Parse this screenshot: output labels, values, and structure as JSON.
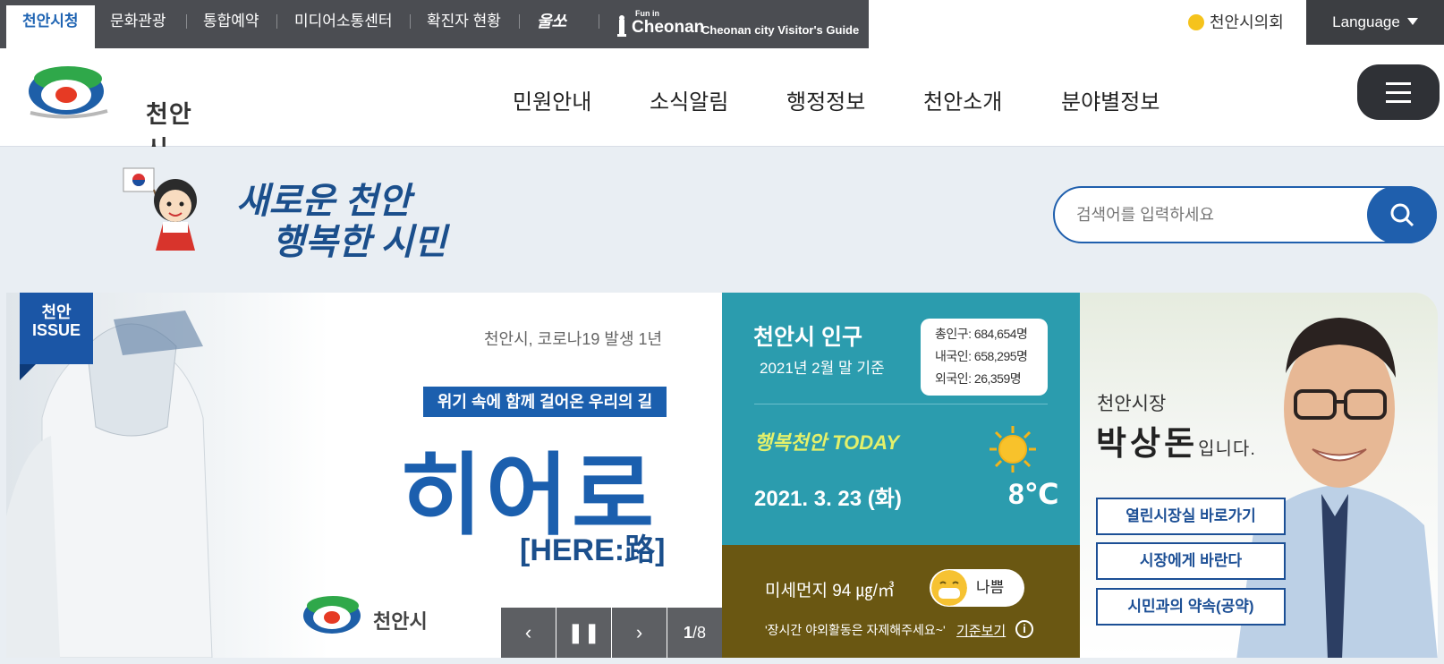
{
  "topbar": {
    "links": [
      "천안시청",
      "문화관광",
      "통합예약",
      "미디어소통센터",
      "확진자 현황"
    ],
    "ulsso": "울쏘",
    "fun_small": "Fun in",
    "fun_brand": "Cheonan",
    "fun_guide": "Cheonan city Visitor's Guide",
    "council": "천안시의회",
    "language": "Language"
  },
  "header": {
    "logo_text": "천안시",
    "nav": [
      "민원안내",
      "소식알림",
      "행정정보",
      "천안소개",
      "분야별정보"
    ]
  },
  "slogan": {
    "line1": "새로운 천안",
    "line2": "행복한 시민"
  },
  "search": {
    "placeholder": "검색어를 입력하세요"
  },
  "issue": {
    "ribbon_line1": "천안",
    "ribbon_line2": "ISSUE",
    "subtitle": "천안시, 코로나19 발생 1년",
    "tag": "위기 속에 함께 걸어온 우리의 길",
    "headline": "히어로",
    "here": "[HERE:路]",
    "logo_text": "천안시",
    "page_current": "1",
    "page_total": "/8"
  },
  "population": {
    "title": "천안시 인구",
    "date": "2021년 2월 말 기준",
    "total": "총인구: 684,654명",
    "native": "내국인: 658,295명",
    "foreign": "외국인: 26,359명",
    "today_label": "행복천안 TODAY",
    "day": "2021. 3. 23 (화)",
    "temp": "8℃"
  },
  "dust": {
    "label": "미세먼지 94 ㎍/㎥",
    "state": "나쁨",
    "message": "'장시간 야외활동은 자제해주세요~'",
    "more": "기준보기",
    "info": "i"
  },
  "mayor": {
    "pre": "천안시장",
    "name": "박상돈",
    "suffix": "입니다.",
    "buttons": [
      "열린시장실 바로가기",
      "시장에게 바란다",
      "시민과의 약속(공약)"
    ]
  },
  "colors": {
    "topbar_bg": "#4b4d52",
    "primary_blue": "#1f5fad",
    "teal": "#2b9cae",
    "dust_brown": "#6a5712"
  }
}
